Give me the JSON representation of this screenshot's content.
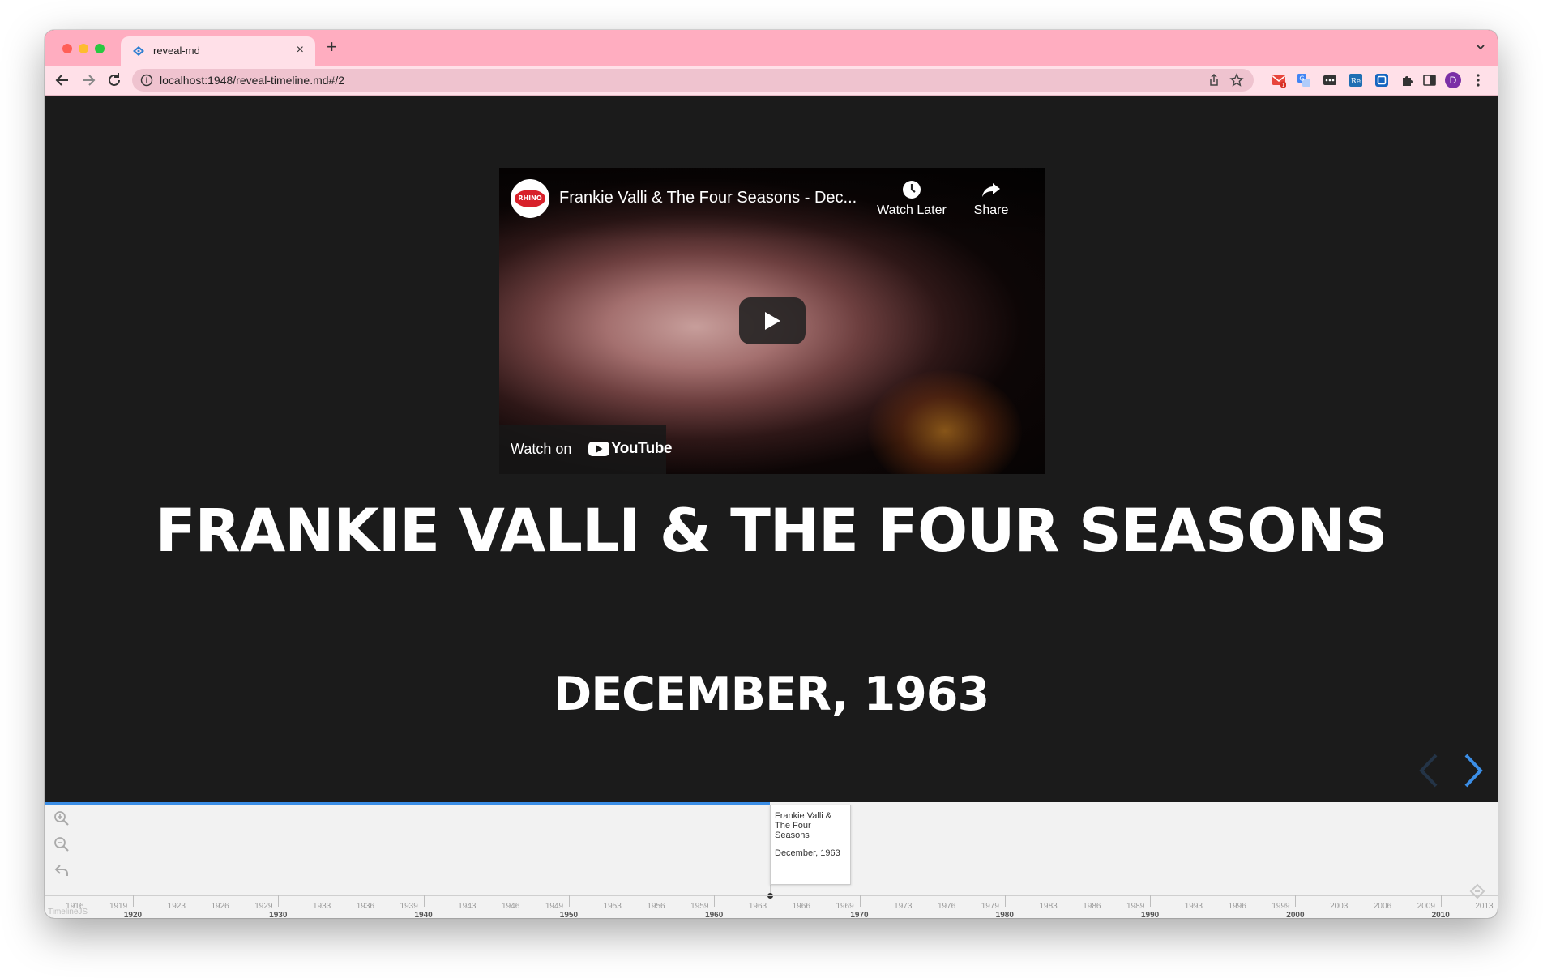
{
  "browser": {
    "tab_title": "reveal-md",
    "new_tab_symbol": "+",
    "close_symbol": "×",
    "url": "localhost:1948/reveal-timeline.md#/2",
    "avatar_initial": "D",
    "gmail_badge": "1",
    "colors": {
      "tabbar": "#ffadc0",
      "toolbar": "#ffe0e8",
      "omnibox": "#efc3cf"
    }
  },
  "video": {
    "channel_logo_text": "RHINO",
    "title": "Frankie Valli & The Four Seasons - Dec...",
    "watch_later_label": "Watch Later",
    "share_label": "Share",
    "watch_on_label": "Watch on",
    "youtube_wordmark": "YouTube"
  },
  "slide": {
    "headline": "FRANKIE VALLI & THE FOUR SEASONS",
    "date": "DECEMBER, 1963",
    "background": "#1b1b1b",
    "nav_accent": "#3b8ee6"
  },
  "timeline": {
    "marker": {
      "title": "Frankie Valli & The Four Seasons",
      "date": "December, 1963"
    },
    "minor_ticks": [
      "1916",
      "1919",
      "1923",
      "1926",
      "1929",
      "1933",
      "1936",
      "1939",
      "1943",
      "1946",
      "1949",
      "1953",
      "1956",
      "1959",
      "1963",
      "1966",
      "1969",
      "1973",
      "1976",
      "1979",
      "1983",
      "1986",
      "1989",
      "1993",
      "1996",
      "1999",
      "2003",
      "2006",
      "2009",
      "2013"
    ],
    "major_ticks": [
      "1920",
      "1930",
      "1940",
      "1950",
      "1960",
      "1970",
      "1980",
      "1990",
      "2000",
      "2010"
    ],
    "branding": "TimelineJS"
  }
}
